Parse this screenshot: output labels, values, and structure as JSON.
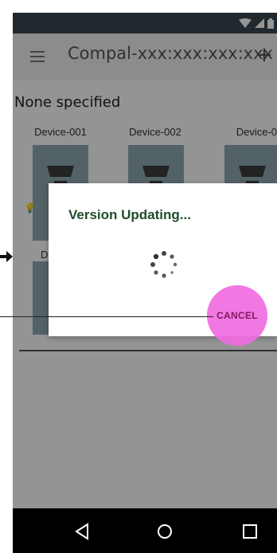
{
  "app_bar": {
    "title": "Compal-xxx:xxx:xxx:xxx",
    "add_icon": "+"
  },
  "section": {
    "title": "None specified"
  },
  "devices": [
    {
      "name": "Device-001"
    },
    {
      "name": "Device-002"
    },
    {
      "name": "Device-0"
    }
  ],
  "second_row_partial_label": "De",
  "dialog": {
    "title": "Version Updating...",
    "cancel_label": "CANCEL"
  },
  "colors": {
    "status_bar": "#37474f",
    "tile": "#8fa9b2",
    "dialog_title": "#1f4d2b",
    "touch_indicator": "#f06be0"
  },
  "icons": [
    "menu-icon",
    "add-icon",
    "wifi-icon",
    "signal-icon",
    "battery-icon",
    "lamp-icon",
    "bulb-icon",
    "spinner-icon",
    "back-icon",
    "home-icon",
    "recents-icon"
  ]
}
